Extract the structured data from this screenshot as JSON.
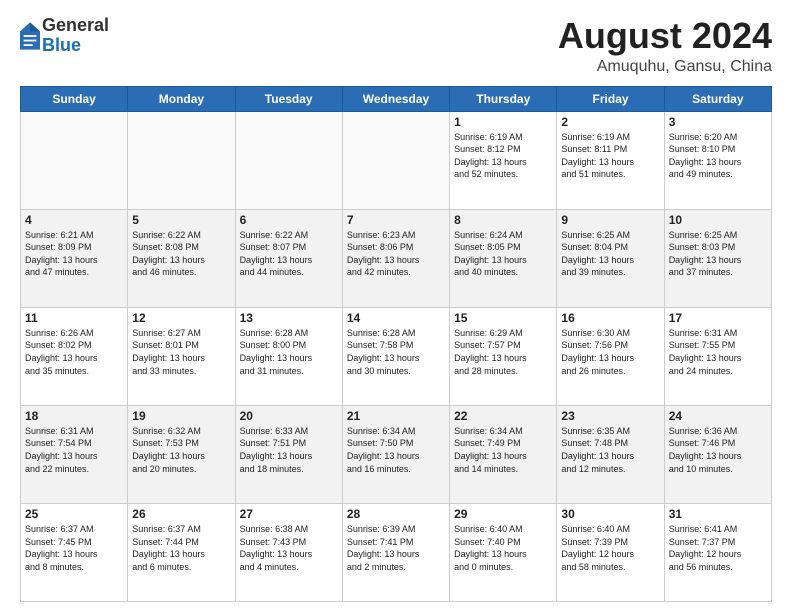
{
  "header": {
    "logo_general": "General",
    "logo_blue": "Blue",
    "main_title": "August 2024",
    "sub_title": "Amuquhu, Gansu, China"
  },
  "weekdays": [
    "Sunday",
    "Monday",
    "Tuesday",
    "Wednesday",
    "Thursday",
    "Friday",
    "Saturday"
  ],
  "rows": [
    [
      {
        "day": "",
        "info": ""
      },
      {
        "day": "",
        "info": ""
      },
      {
        "day": "",
        "info": ""
      },
      {
        "day": "",
        "info": ""
      },
      {
        "day": "1",
        "info": "Sunrise: 6:19 AM\nSunset: 8:12 PM\nDaylight: 13 hours\nand 52 minutes."
      },
      {
        "day": "2",
        "info": "Sunrise: 6:19 AM\nSunset: 8:11 PM\nDaylight: 13 hours\nand 51 minutes."
      },
      {
        "day": "3",
        "info": "Sunrise: 6:20 AM\nSunset: 8:10 PM\nDaylight: 13 hours\nand 49 minutes."
      }
    ],
    [
      {
        "day": "4",
        "info": "Sunrise: 6:21 AM\nSunset: 8:09 PM\nDaylight: 13 hours\nand 47 minutes."
      },
      {
        "day": "5",
        "info": "Sunrise: 6:22 AM\nSunset: 8:08 PM\nDaylight: 13 hours\nand 46 minutes."
      },
      {
        "day": "6",
        "info": "Sunrise: 6:22 AM\nSunset: 8:07 PM\nDaylight: 13 hours\nand 44 minutes."
      },
      {
        "day": "7",
        "info": "Sunrise: 6:23 AM\nSunset: 8:06 PM\nDaylight: 13 hours\nand 42 minutes."
      },
      {
        "day": "8",
        "info": "Sunrise: 6:24 AM\nSunset: 8:05 PM\nDaylight: 13 hours\nand 40 minutes."
      },
      {
        "day": "9",
        "info": "Sunrise: 6:25 AM\nSunset: 8:04 PM\nDaylight: 13 hours\nand 39 minutes."
      },
      {
        "day": "10",
        "info": "Sunrise: 6:25 AM\nSunset: 8:03 PM\nDaylight: 13 hours\nand 37 minutes."
      }
    ],
    [
      {
        "day": "11",
        "info": "Sunrise: 6:26 AM\nSunset: 8:02 PM\nDaylight: 13 hours\nand 35 minutes."
      },
      {
        "day": "12",
        "info": "Sunrise: 6:27 AM\nSunset: 8:01 PM\nDaylight: 13 hours\nand 33 minutes."
      },
      {
        "day": "13",
        "info": "Sunrise: 6:28 AM\nSunset: 8:00 PM\nDaylight: 13 hours\nand 31 minutes."
      },
      {
        "day": "14",
        "info": "Sunrise: 6:28 AM\nSunset: 7:58 PM\nDaylight: 13 hours\nand 30 minutes."
      },
      {
        "day": "15",
        "info": "Sunrise: 6:29 AM\nSunset: 7:57 PM\nDaylight: 13 hours\nand 28 minutes."
      },
      {
        "day": "16",
        "info": "Sunrise: 6:30 AM\nSunset: 7:56 PM\nDaylight: 13 hours\nand 26 minutes."
      },
      {
        "day": "17",
        "info": "Sunrise: 6:31 AM\nSunset: 7:55 PM\nDaylight: 13 hours\nand 24 minutes."
      }
    ],
    [
      {
        "day": "18",
        "info": "Sunrise: 6:31 AM\nSunset: 7:54 PM\nDaylight: 13 hours\nand 22 minutes."
      },
      {
        "day": "19",
        "info": "Sunrise: 6:32 AM\nSunset: 7:53 PM\nDaylight: 13 hours\nand 20 minutes."
      },
      {
        "day": "20",
        "info": "Sunrise: 6:33 AM\nSunset: 7:51 PM\nDaylight: 13 hours\nand 18 minutes."
      },
      {
        "day": "21",
        "info": "Sunrise: 6:34 AM\nSunset: 7:50 PM\nDaylight: 13 hours\nand 16 minutes."
      },
      {
        "day": "22",
        "info": "Sunrise: 6:34 AM\nSunset: 7:49 PM\nDaylight: 13 hours\nand 14 minutes."
      },
      {
        "day": "23",
        "info": "Sunrise: 6:35 AM\nSunset: 7:48 PM\nDaylight: 13 hours\nand 12 minutes."
      },
      {
        "day": "24",
        "info": "Sunrise: 6:36 AM\nSunset: 7:46 PM\nDaylight: 13 hours\nand 10 minutes."
      }
    ],
    [
      {
        "day": "25",
        "info": "Sunrise: 6:37 AM\nSunset: 7:45 PM\nDaylight: 13 hours\nand 8 minutes."
      },
      {
        "day": "26",
        "info": "Sunrise: 6:37 AM\nSunset: 7:44 PM\nDaylight: 13 hours\nand 6 minutes."
      },
      {
        "day": "27",
        "info": "Sunrise: 6:38 AM\nSunset: 7:43 PM\nDaylight: 13 hours\nand 4 minutes."
      },
      {
        "day": "28",
        "info": "Sunrise: 6:39 AM\nSunset: 7:41 PM\nDaylight: 13 hours\nand 2 minutes."
      },
      {
        "day": "29",
        "info": "Sunrise: 6:40 AM\nSunset: 7:40 PM\nDaylight: 13 hours\nand 0 minutes."
      },
      {
        "day": "30",
        "info": "Sunrise: 6:40 AM\nSunset: 7:39 PM\nDaylight: 12 hours\nand 58 minutes."
      },
      {
        "day": "31",
        "info": "Sunrise: 6:41 AM\nSunset: 7:37 PM\nDaylight: 12 hours\nand 56 minutes."
      }
    ]
  ]
}
